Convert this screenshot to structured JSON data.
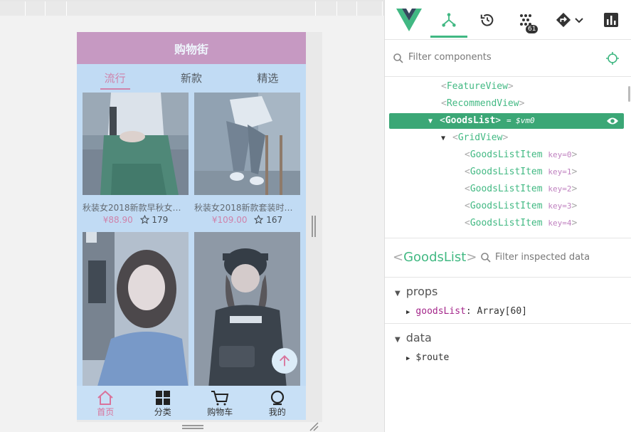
{
  "app": {
    "nav_title": "购物街",
    "tabs": [
      {
        "label": "流行",
        "active": true
      },
      {
        "label": "新款",
        "active": false
      },
      {
        "label": "精选",
        "active": false
      }
    ],
    "goods": [
      {
        "title": "秋装女2018新款早秋女装…",
        "price": "¥88.90",
        "collect": "179"
      },
      {
        "title": "秋装女2018新款套装时尚…",
        "price": "¥109.00",
        "collect": "167"
      }
    ],
    "tabbar": [
      {
        "label": "首页",
        "icon": "home-icon",
        "active": true
      },
      {
        "label": "分类",
        "icon": "category-icon",
        "active": false
      },
      {
        "label": "购物车",
        "icon": "cart-icon",
        "active": false
      },
      {
        "label": "我的",
        "icon": "profile-icon",
        "active": false
      }
    ],
    "colors": {
      "nav": "#cf8fb9",
      "accent": "#d9739b",
      "background": "#c8e0f6"
    }
  },
  "devtools": {
    "badge_count": "61",
    "filter_placeholder": "Filter components",
    "tree": [
      {
        "name": "FeatureView"
      },
      {
        "name": "RecommendView"
      },
      {
        "name": "GoodsList",
        "vm": "= $vm0",
        "selected": true
      },
      {
        "name": "GridView"
      },
      {
        "name": "GoodsListItem",
        "key": "key=0"
      },
      {
        "name": "GoodsListItem",
        "key": "key=1"
      },
      {
        "name": "GoodsListItem",
        "key": "key=2"
      },
      {
        "name": "GoodsListItem",
        "key": "key=3"
      },
      {
        "name": "GoodsListItem",
        "key": "key=4"
      }
    ],
    "inspected_name": "GoodsList",
    "inspected_filter_placeholder": "Filter inspected data",
    "sections": [
      {
        "title": "props",
        "items": [
          {
            "key": "goodsList",
            "value": ": Array[60]"
          }
        ]
      },
      {
        "title": "data",
        "items": [
          {
            "key": "$route",
            "value": ""
          }
        ]
      }
    ],
    "accent": "#41b883"
  }
}
